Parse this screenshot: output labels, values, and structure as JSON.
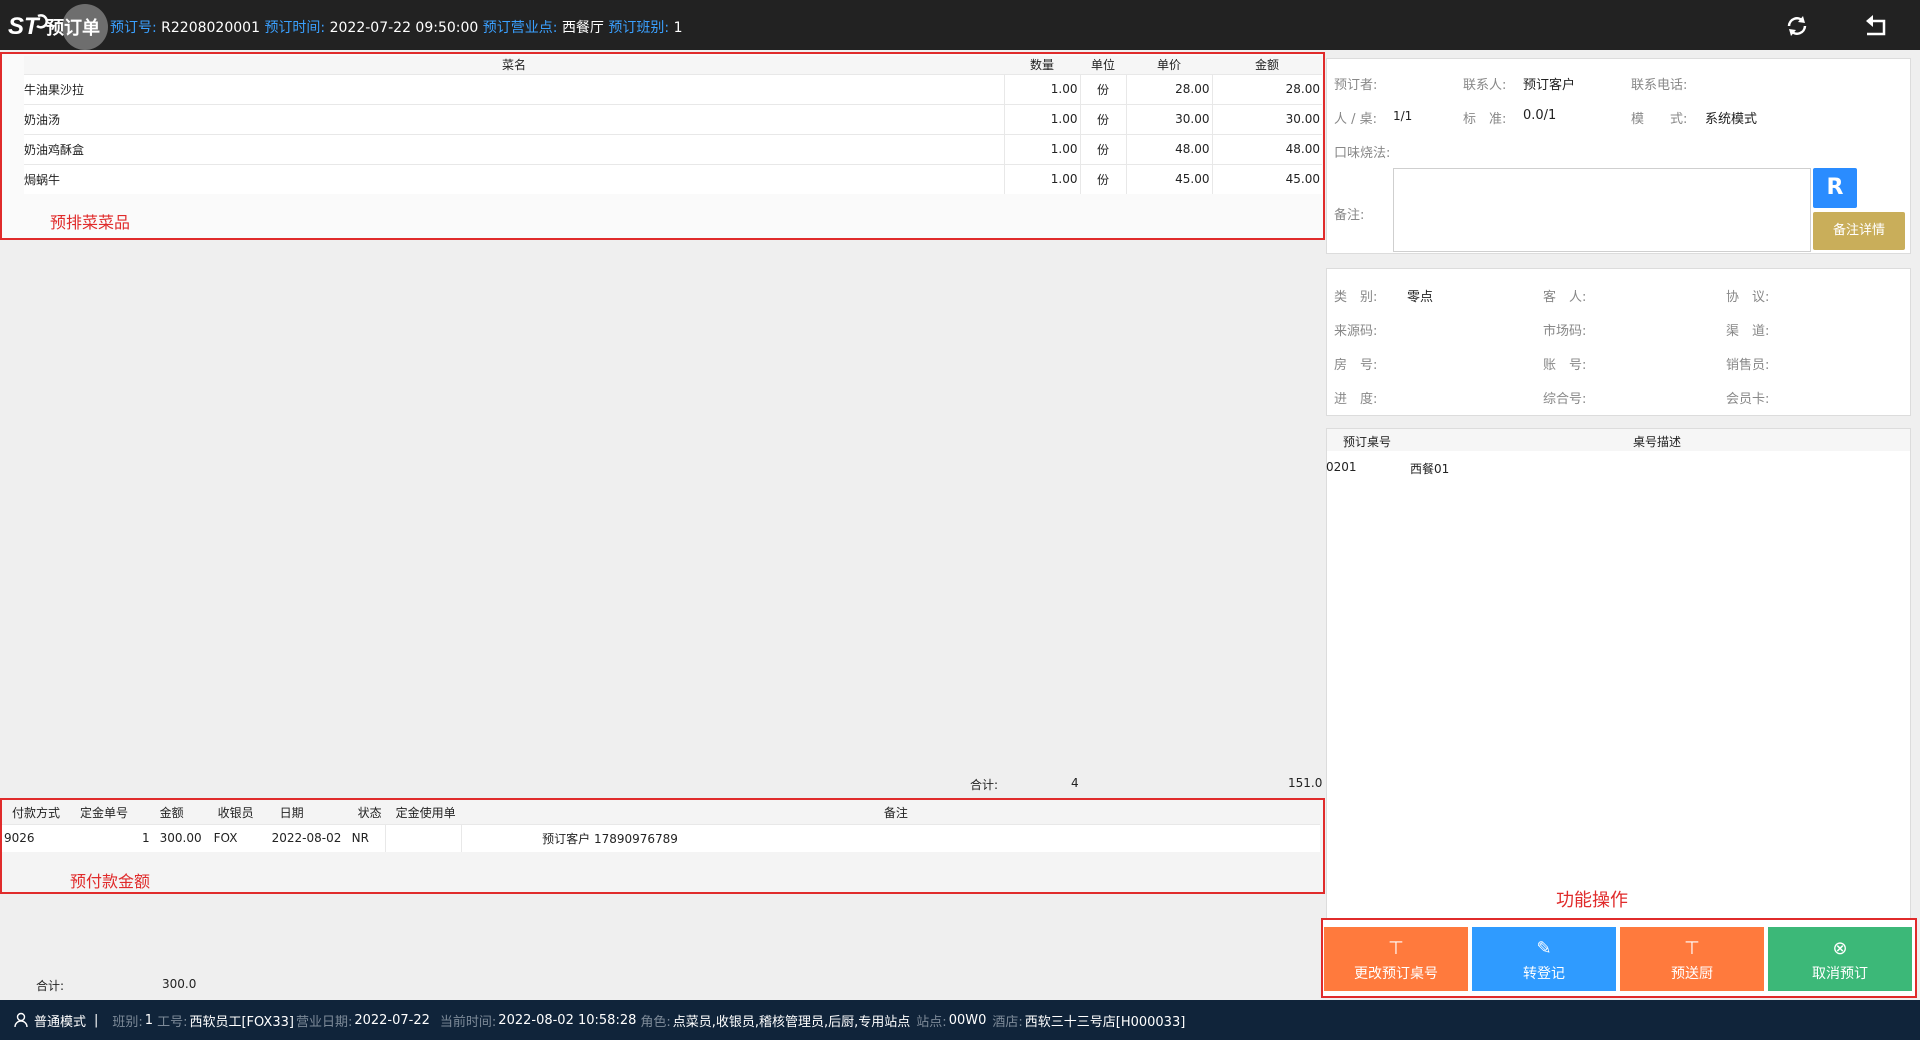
{
  "header": {
    "title": "预订单",
    "order_no_label": "预订号:",
    "order_no": "R2208020001",
    "time_label": "预订时间:",
    "time": "2022-07-22 09:50:00",
    "outlet_label": "预订营业点:",
    "outlet": "西餐厅",
    "shift_label": "预订班别:",
    "shift": "1",
    "icons": [
      "refresh-icon",
      "back-icon"
    ]
  },
  "dishes": {
    "headers": {
      "name": "菜名",
      "qty": "数量",
      "unit": "单位",
      "price": "单价",
      "amount": "金额"
    },
    "rows": [
      {
        "name": "牛油果沙拉",
        "qty": "1.00",
        "unit": "份",
        "price": "28.00",
        "amount": "28.00"
      },
      {
        "name": "奶油汤",
        "qty": "1.00",
        "unit": "份",
        "price": "30.00",
        "amount": "30.00"
      },
      {
        "name": "奶油鸡酥盒",
        "qty": "1.00",
        "unit": "份",
        "price": "48.00",
        "amount": "48.00"
      },
      {
        "name": "焗蜗牛",
        "qty": "1.00",
        "unit": "份",
        "price": "45.00",
        "amount": "45.00"
      }
    ],
    "caption": "预排菜菜品",
    "total_label": "合计:",
    "total_qty": "4",
    "total_amount": "151.0"
  },
  "deposit": {
    "headers": {
      "method": "付款方式",
      "no": "定金单号",
      "amount": "金额",
      "cashier": "收银员",
      "date": "日期",
      "status": "状态",
      "use": "定金使用单",
      "note": "备注"
    },
    "rows": [
      {
        "method": "9026",
        "no": "1",
        "amount": "300.00",
        "cashier": "FOX",
        "date": "2022-08-02",
        "status": "NR",
        "use": "",
        "note": "预订客户 17890976789"
      }
    ],
    "caption": "预付款金额",
    "total_label": "合计:",
    "total_amount": "300.0"
  },
  "booker": {
    "booker_label": "预订者:",
    "contact_label": "联系人:",
    "contact": "预订客户",
    "phone_label": "联系电话:",
    "persons_label": "人 / 桌:",
    "persons": "1/1",
    "standard_label": "标　准:",
    "standard": "0.0/1",
    "mode_label": "模　　式:",
    "mode": "系统模式",
    "taste_label": "口味烧法:",
    "note_label": "备注:",
    "r_button": "R",
    "note_detail_button": "备注详情"
  },
  "info": {
    "category_label": "类　别:",
    "category": "零点",
    "guest_label": "客　人:",
    "agreement_label": "协　议:",
    "source_label": "来源码:",
    "market_label": "市场码:",
    "channel_label": "渠　道:",
    "room_label": "房　号:",
    "account_label": "账　号:",
    "sales_label": "销售员:",
    "progress_label": "进　度:",
    "composite_label": "综合号:",
    "member_label": "会员卡:"
  },
  "tables": {
    "headers": {
      "no": "预订桌号",
      "desc": "桌号描述"
    },
    "rows": [
      {
        "no": "0201",
        "desc": "西餐01"
      }
    ]
  },
  "functions": {
    "caption": "功能操作",
    "buttons": [
      {
        "label": "更改预订桌号",
        "color": "#ff7a3d"
      },
      {
        "label": "转登记",
        "color": "#2f9bff"
      },
      {
        "label": "预送厨",
        "color": "#ff7a3d"
      },
      {
        "label": "取消预订",
        "color": "#3cb878"
      }
    ]
  },
  "footer": {
    "mode": "普通模式",
    "shift_label": "班别:",
    "shift": "1",
    "staff_label": "工号:",
    "staff": "西软员工[FOX33]",
    "bizdate_label": "营业日期:",
    "bizdate": "2022-07-22",
    "now_label": "当前时间:",
    "now": "2022-08-02 10:58:28",
    "role_label": "角色:",
    "role": "点菜员,收银员,稽核管理员,后厨,专用站点",
    "station_label": "站点:",
    "station": "00W0",
    "hotel_label": "酒店:",
    "hotel": "西软三十三号店[H000033]"
  }
}
